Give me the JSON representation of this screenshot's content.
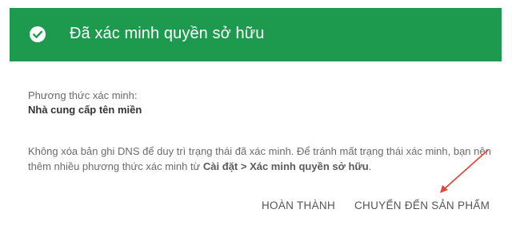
{
  "header": {
    "title": "Đã xác minh quyền sở hữu",
    "icon": "check-circle-icon",
    "color": "#1e9a4f"
  },
  "method": {
    "label": "Phương thức xác minh:",
    "value": "Nhà cung cấp tên miền"
  },
  "info": {
    "text_before": "Không xóa bản ghi DNS để duy trì trạng thái đã xác minh. Để tránh mất trạng thái xác minh, bạn nên thêm nhiều phương thức xác minh từ ",
    "link_text": "Cài đặt > Xác minh quyền sở hữu",
    "text_after": "."
  },
  "actions": {
    "done_label": "HOÀN THÀNH",
    "product_label": "CHUYỂN ĐẾN SẢN PHẨM"
  },
  "annotation": {
    "icon": "red-arrow-icon",
    "color": "#e0483c"
  }
}
